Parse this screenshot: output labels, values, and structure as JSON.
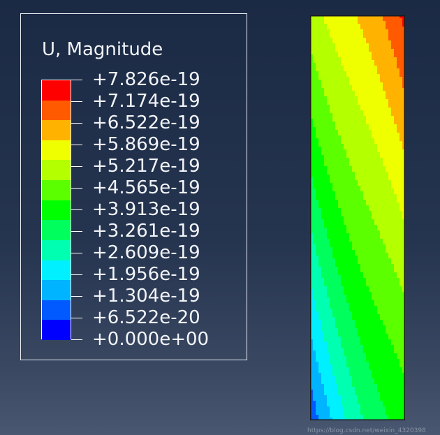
{
  "legend": {
    "title": "U, Magnitude",
    "labels": [
      "+7.826e-19",
      "+7.174e-19",
      "+6.522e-19",
      "+5.869e-19",
      "+5.217e-19",
      "+4.565e-19",
      "+3.913e-19",
      "+3.261e-19",
      "+2.609e-19",
      "+1.956e-19",
      "+1.304e-19",
      "+6.522e-20",
      "+0.000e+00"
    ],
    "colors": [
      "#ff0000",
      "#ff5a00",
      "#ffb200",
      "#f0ff00",
      "#b4ff00",
      "#5cff00",
      "#00ff00",
      "#00ff5c",
      "#00ffb0",
      "#00f0ff",
      "#00b4ff",
      "#005aff",
      "#0000ff"
    ]
  },
  "watermark": "https://blog.csdn.net/weixin_4320398"
}
